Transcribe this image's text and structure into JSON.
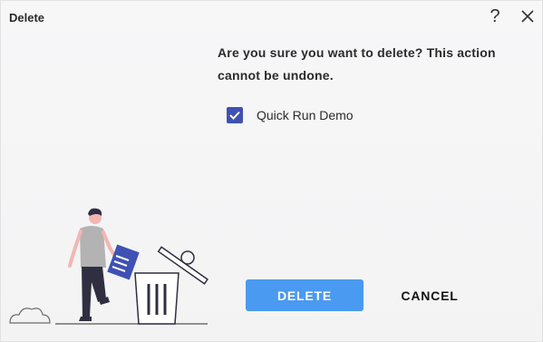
{
  "dialog": {
    "title": "Delete",
    "help_icon": "question-mark-icon",
    "close_icon": "close-icon",
    "message": "Are you sure you want to delete? This action cannot be undone.",
    "checkbox": {
      "label": "Quick Run Demo",
      "checked": true
    },
    "delete_label": "DELETE",
    "cancel_label": "CANCEL",
    "colors": {
      "accent": "#4a9af2",
      "checkbox": "#3f51b5"
    }
  }
}
